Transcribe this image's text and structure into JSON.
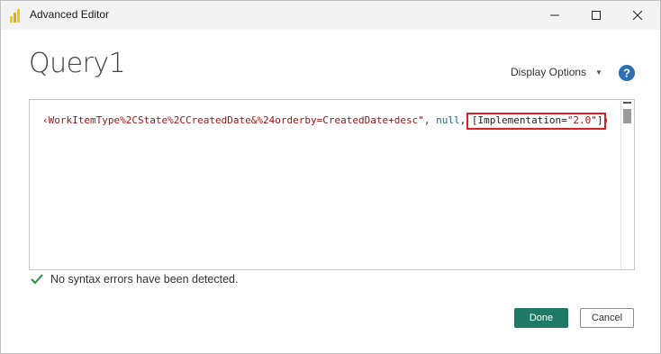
{
  "window": {
    "title": "Advanced Editor"
  },
  "header": {
    "query_name": "Query1",
    "display_options_label": "Display Options"
  },
  "editor": {
    "tokens": {
      "string_part": "‹WorkItemType%2CState%2CCreatedDate&%24orderby=CreatedDate+desc\"",
      "sep1": ", ",
      "null_kw": "null",
      "sep2": ", ",
      "bracket_open": "[Implementation=",
      "impl_value": "\"2.0\"",
      "bracket_close": "])"
    }
  },
  "status": {
    "message": "No syntax errors have been detected."
  },
  "footer": {
    "done_label": "Done",
    "cancel_label": "Cancel"
  },
  "colors": {
    "accent": "#1c7a67",
    "highlight": "#d92027",
    "success": "#2e8b3e",
    "help": "#2f6fb5"
  }
}
